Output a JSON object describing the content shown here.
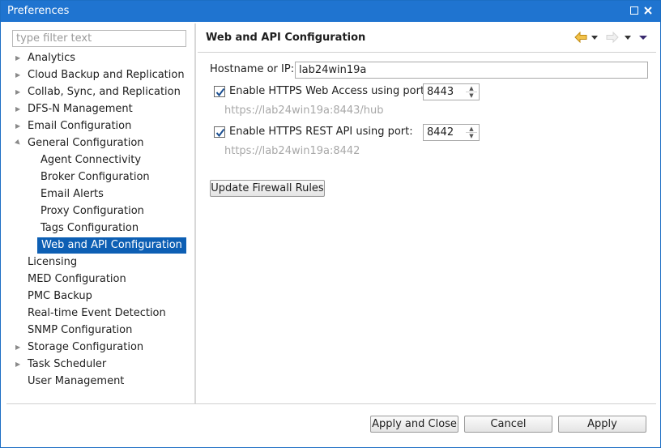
{
  "window": {
    "title": "Preferences"
  },
  "filter": {
    "placeholder": "type filter text"
  },
  "tree": {
    "items": [
      {
        "label": "Analytics",
        "expandable": true
      },
      {
        "label": "Cloud Backup and Replication",
        "expandable": true
      },
      {
        "label": "Collab, Sync, and Replication",
        "expandable": true
      },
      {
        "label": "DFS-N Management",
        "expandable": true
      },
      {
        "label": "Email Configuration",
        "expandable": true
      },
      {
        "label": "General Configuration",
        "expanded": true
      },
      {
        "label": "Agent Connectivity"
      },
      {
        "label": "Broker Configuration"
      },
      {
        "label": "Email Alerts"
      },
      {
        "label": "Proxy Configuration"
      },
      {
        "label": "Tags Configuration"
      },
      {
        "label": "Web and API Configuration",
        "selected": true
      },
      {
        "label": "Licensing"
      },
      {
        "label": "MED Configuration"
      },
      {
        "label": "PMC Backup"
      },
      {
        "label": "Real-time Event Detection"
      },
      {
        "label": "SNMP Configuration"
      },
      {
        "label": "Storage Configuration",
        "expandable": true
      },
      {
        "label": "Task Scheduler",
        "expandable": true
      },
      {
        "label": "User Management"
      }
    ]
  },
  "page": {
    "title": "Web and API Configuration",
    "hostname_label": "Hostname or IP:",
    "hostname_value": "lab24win19a",
    "https_web": {
      "label": "Enable HTTPS Web Access using port:",
      "checked": true,
      "port": "8443",
      "url": "https://lab24win19a:8443/hub"
    },
    "https_rest": {
      "label": "Enable HTTPS REST API using port:",
      "checked": true,
      "port": "8442",
      "url": "https://lab24win19a:8442"
    },
    "update_button": "Update Firewall Rules"
  },
  "footer": {
    "apply_close": "Apply and Close",
    "cancel": "Cancel",
    "apply": "Apply"
  },
  "colors": {
    "titlebar": "#1f74d0",
    "selection": "#0d5fb4",
    "hint_text": "#a8a8a8"
  },
  "icons": [
    "back-arrow-icon",
    "back-menu-icon",
    "forward-arrow-icon",
    "forward-menu-icon",
    "view-menu-icon",
    "maximize-icon",
    "close-icon",
    "checkmark-icon"
  ]
}
